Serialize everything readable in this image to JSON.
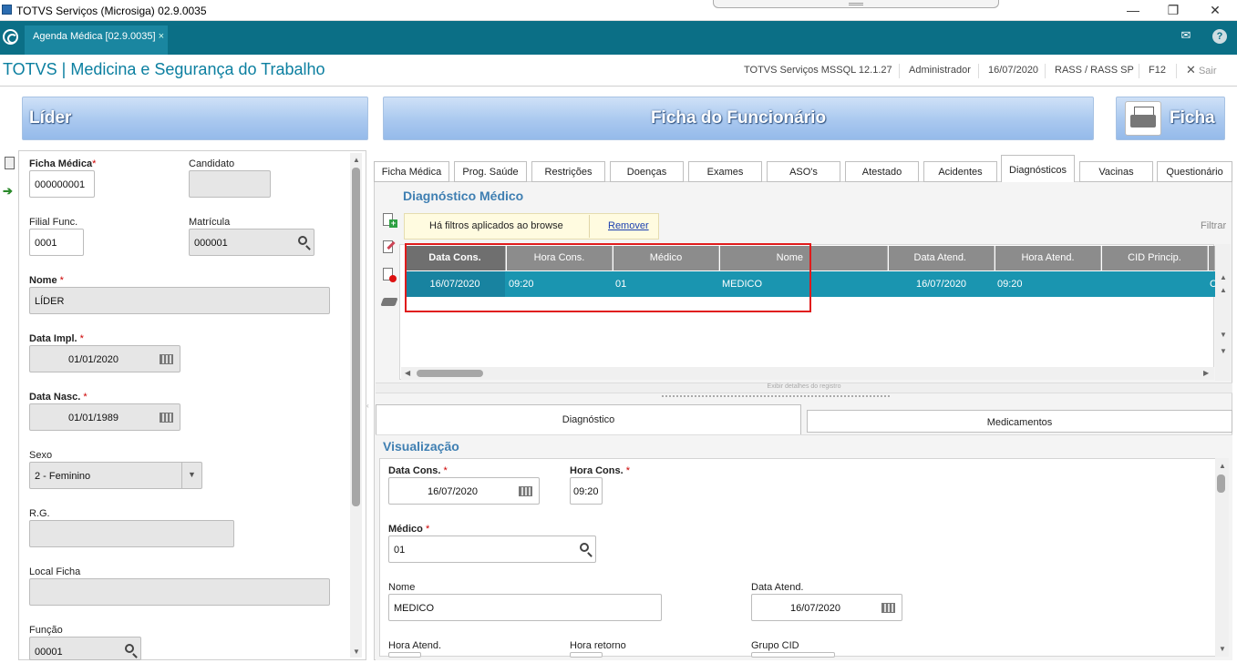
{
  "window": {
    "title": "TOTVS Serviços (Microsiga) 02.9.0035"
  },
  "app_tab": {
    "label": "Agenda Médica [02.9.0035]",
    "close": "×"
  },
  "module": {
    "title": "TOTVS | Medicina e Segurança do Trabalho"
  },
  "status": [
    "TOTVS Serviços MSSQL 12.1.27",
    "Administrador",
    "16/07/2020",
    "RASS / RASS SP",
    "F12"
  ],
  "exit_label": "Sair",
  "banners": {
    "left": "Líder",
    "center": "Ficha do Funcionário",
    "print": "Ficha"
  },
  "left_form": {
    "ficha_medica": {
      "label": "Ficha Médica",
      "value": "000000001"
    },
    "candidato": {
      "label": "Candidato",
      "value": ""
    },
    "filial": {
      "label": "Filial Func.",
      "value": "0001"
    },
    "matricula": {
      "label": "Matrícula",
      "value": "000001"
    },
    "nome": {
      "label": "Nome",
      "value": "LÍDER"
    },
    "data_impl": {
      "label": "Data Impl.",
      "value": "01/01/2020"
    },
    "data_nasc": {
      "label": "Data Nasc.",
      "value": "01/01/1989"
    },
    "sexo": {
      "label": "Sexo",
      "value": "2 - Feminino"
    },
    "rg": {
      "label": "R.G.",
      "value": ""
    },
    "local_ficha": {
      "label": "Local Ficha",
      "value": ""
    },
    "funcao": {
      "label": "Função",
      "value": "00001"
    }
  },
  "tabs": [
    "Ficha Médica",
    "Prog. Saúde",
    "Restrições",
    "Doenças",
    "Exames",
    "ASO's",
    "Atestado",
    "Acidentes",
    "Diagnósticos",
    "Vacinas",
    "Questionário"
  ],
  "active_tab": "Diagnósticos",
  "diag": {
    "title": "Diagnóstico Médico",
    "filter_text": "Há filtros aplicados ao browse",
    "remove_link": "Remover",
    "filter_button": "Filtrar",
    "columns": [
      "Data Cons.",
      "Hora Cons.",
      "Médico",
      "Nome",
      "Data Atend.",
      "Hora Atend.",
      "CID Princip."
    ],
    "row": [
      "16/07/2020",
      "09:20",
      "01",
      "MEDICO",
      "16/07/2020",
      "09:20",
      "C"
    ],
    "details_bar": "Exibir detalhes do registro"
  },
  "bottom_tabs": [
    "Diagnóstico",
    "Medicamentos"
  ],
  "visualizacao": {
    "title": "Visualização",
    "data_cons": {
      "label": "Data Cons.",
      "value": "16/07/2020"
    },
    "hora_cons": {
      "label": "Hora Cons.",
      "value": "09:20"
    },
    "medico": {
      "label": "Médico",
      "value": "01"
    },
    "nome": {
      "label": "Nome",
      "value": "MEDICO"
    },
    "data_atend": {
      "label": "Data Atend.",
      "value": "16/07/2020"
    },
    "hora_atend": {
      "label": "Hora Atend.",
      "value": ""
    },
    "hora_retorno": {
      "label": "Hora retorno",
      "value": ""
    },
    "grupo_cid": {
      "label": "Grupo CID",
      "value": ""
    }
  },
  "colors": {
    "teal": "#0b6f86",
    "accent": "#1a95b0",
    "highlight_box": "#e01b1b"
  }
}
